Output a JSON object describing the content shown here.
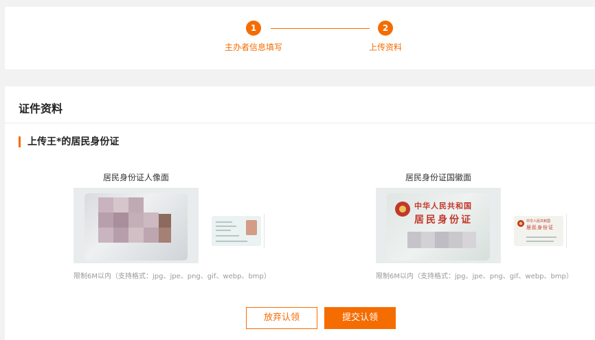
{
  "steps": [
    {
      "number": "1",
      "label": "主办者信息填写"
    },
    {
      "number": "2",
      "label": "上传资料"
    }
  ],
  "card": {
    "title": "证件资料",
    "section_title": "上传王*的居民身份证"
  },
  "uploads": [
    {
      "title": "居民身份证人像面",
      "hint": "限制6M以内（支持格式：jpg、jpe、png、gif、webp、bmp）"
    },
    {
      "title": "居民身份证国徽面",
      "hint": "限制6M以内（支持格式：jpg、jpe、png、gif、webp、bmp）"
    }
  ],
  "emblem_side": {
    "line1": "中华人民共和国",
    "line2": "居民身份证"
  },
  "actions": {
    "cancel_label": "放弃认领",
    "submit_label": "提交认领"
  },
  "colors": {
    "accent": "#f56c00",
    "background": "#f2f2f2"
  }
}
